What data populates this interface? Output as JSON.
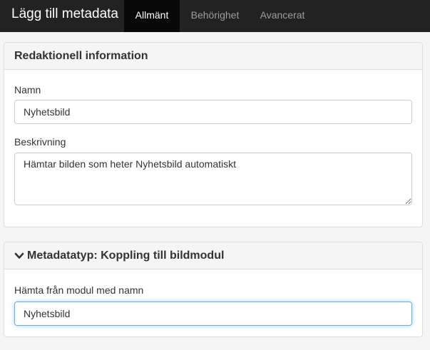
{
  "navbar": {
    "brand": "Lägg till metadata",
    "tabs": [
      {
        "label": "Allmänt",
        "active": true
      },
      {
        "label": "Behörighet",
        "active": false
      },
      {
        "label": "Avancerat",
        "active": false
      }
    ]
  },
  "editorial": {
    "heading": "Redaktionell information",
    "name_label": "Namn",
    "name_value": "Nyhetsbild",
    "description_label": "Beskrivning",
    "description_value": "Hämtar bilden som heter Nyhetsbild automatiskt"
  },
  "metadata_type": {
    "heading": "Metadatatyp: Koppling till bildmodul",
    "icon": "chevron-down-icon",
    "module_label": "Hämta från modul med namn",
    "module_value": "Nyhetsbild"
  },
  "colors": {
    "navbar_bg": "#222222",
    "active_tab_bg": "#080808",
    "focus_border": "#66afe9"
  }
}
